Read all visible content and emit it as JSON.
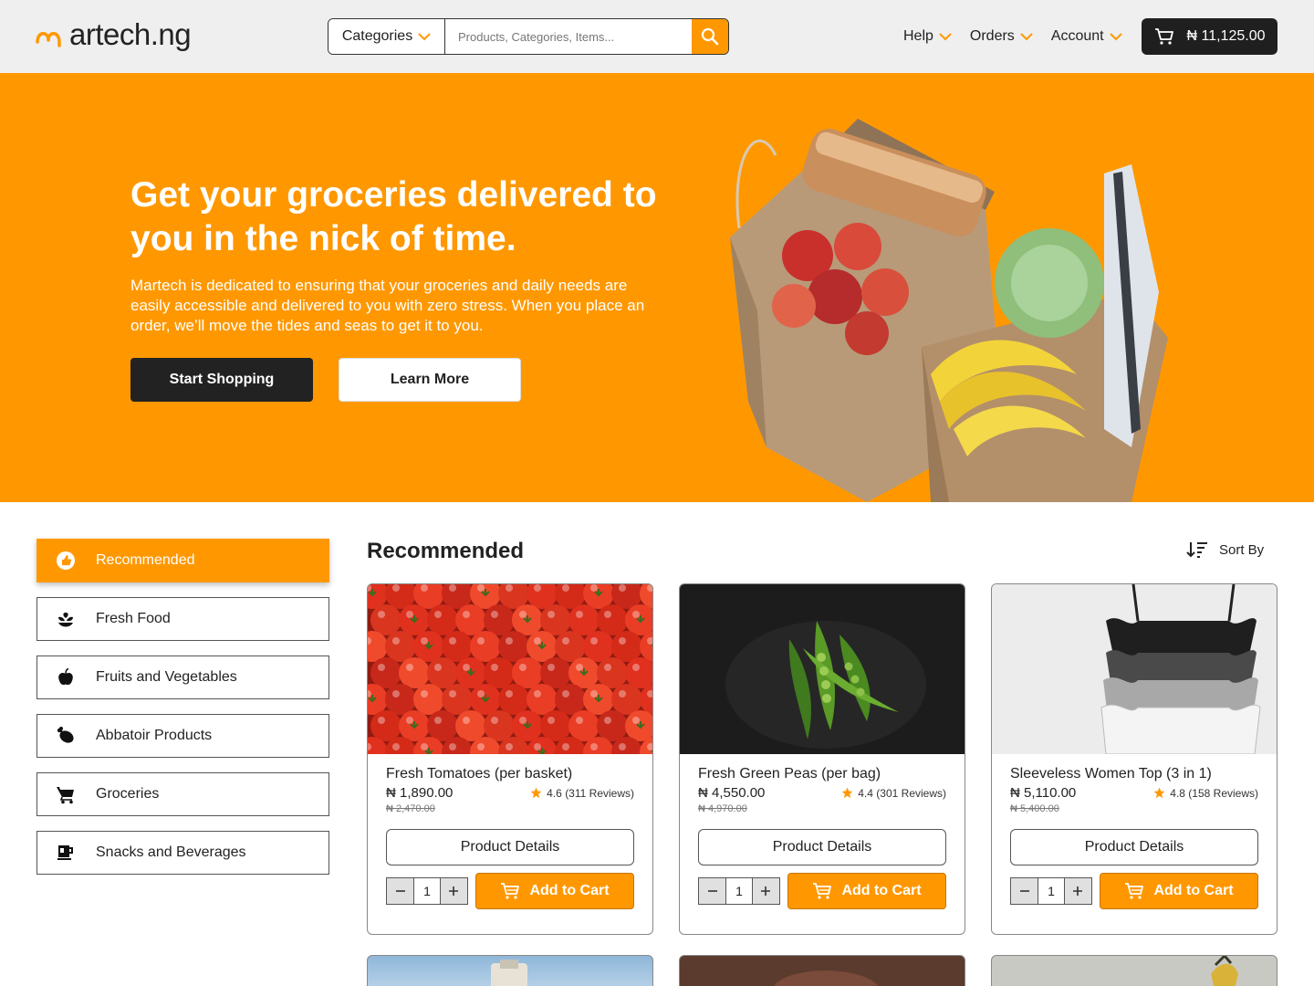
{
  "header": {
    "logo_text": "artech.ng",
    "categories_label": "Categories",
    "search_placeholder": "Products, Categories, Items...",
    "nav": [
      {
        "label": "Help"
      },
      {
        "label": "Orders"
      },
      {
        "label": "Account"
      }
    ],
    "cart_total": "₦ 11,125.00"
  },
  "hero": {
    "title": "Get your groceries delivered to you in the nick of time.",
    "description": "Martech is dedicated to ensuring that your groceries and daily needs are easily accessible and delivered to you with zero stress. When you place an order, we’ll move the tides and seas to get it to you.",
    "primary_button": "Start Shopping",
    "secondary_button": "Learn More"
  },
  "sidebar": {
    "items": [
      {
        "label": "Recommended",
        "icon": "thumbs-up-icon",
        "active": true
      },
      {
        "label": "Fresh Food",
        "icon": "plant-icon",
        "active": false
      },
      {
        "label": "Fruits and Vegetables",
        "icon": "apple-icon",
        "active": false
      },
      {
        "label": "Abbatoir Products",
        "icon": "meat-icon",
        "active": false
      },
      {
        "label": "Groceries",
        "icon": "cart-icon",
        "active": false
      },
      {
        "label": "Snacks and Beverages",
        "icon": "mug-icon",
        "active": false
      }
    ]
  },
  "main": {
    "title": "Recommended",
    "sort_label": "Sort By",
    "product_details_label": "Product Details",
    "add_to_cart_label": "Add to Cart",
    "products": [
      {
        "name": "Fresh Tomatoes (per basket)",
        "price": "₦ 1,890.00",
        "old_price": "₦ 2,470.00",
        "rating": "4.6 (311 Reviews)",
        "qty": "1"
      },
      {
        "name": "Fresh Green Peas (per bag)",
        "price": "₦ 4,550.00",
        "old_price": "₦ 4,970.00",
        "rating": "4.4 (301 Reviews)",
        "qty": "1"
      },
      {
        "name": "Sleeveless Women Top (3 in 1)",
        "price": "₦ 5,110.00",
        "old_price": "₦ 5,400.00",
        "rating": "4.8 (158 Reviews)",
        "qty": "1"
      }
    ]
  },
  "colors": {
    "brand_orange": "#ff9800",
    "dark": "#1f1f1f",
    "header_bg": "#efefef"
  }
}
